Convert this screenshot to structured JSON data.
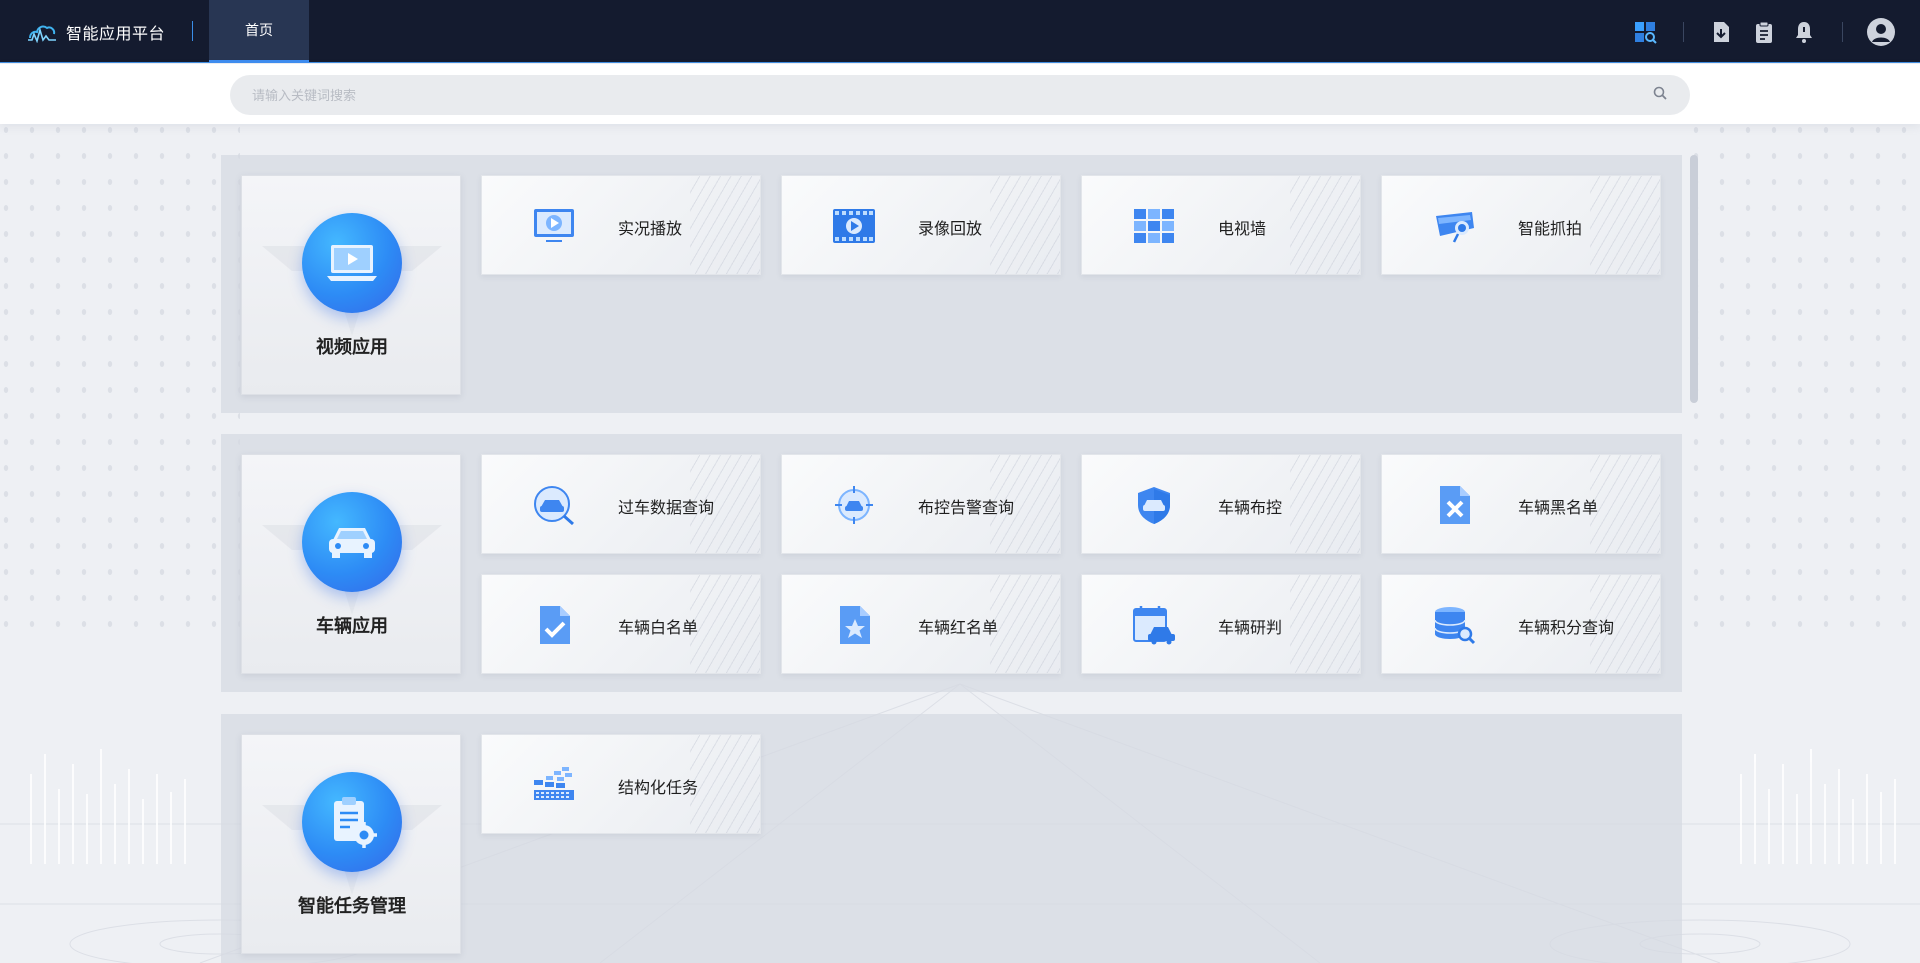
{
  "app": {
    "title": "智能应用平台"
  },
  "nav": {
    "tabs": [
      {
        "label": "首页",
        "active": true
      }
    ]
  },
  "toolbar": {
    "icons": [
      "app-grid-icon",
      "download-file-icon",
      "clipboard-icon",
      "bell-icon",
      "user-avatar-icon"
    ]
  },
  "search": {
    "placeholder": "请输入关键词搜索"
  },
  "colors": {
    "accent": "#2d8bf5",
    "topbar": "#141b2f",
    "active_tab": "#283653"
  },
  "groups": [
    {
      "category": "视频应用",
      "icon": "video-monitor-icon",
      "items": [
        {
          "label": "实况播放",
          "icon": "live-monitor-icon"
        },
        {
          "label": "录像回放",
          "icon": "video-playback-icon"
        },
        {
          "label": "电视墙",
          "icon": "tv-wall-icon"
        },
        {
          "label": "智能抓拍",
          "icon": "camera-capture-icon"
        }
      ]
    },
    {
      "category": "车辆应用",
      "icon": "car-icon",
      "items": [
        {
          "label": "过车数据查询",
          "icon": "car-search-icon"
        },
        {
          "label": "布控告警查询",
          "icon": "target-alarm-icon"
        },
        {
          "label": "车辆布控",
          "icon": "car-shield-icon"
        },
        {
          "label": "车辆黑名单",
          "icon": "blacklist-file-icon"
        },
        {
          "label": "车辆白名单",
          "icon": "whitelist-file-icon"
        },
        {
          "label": "车辆红名单",
          "icon": "redlist-file-icon"
        },
        {
          "label": "车辆研判",
          "icon": "calendar-car-icon"
        },
        {
          "label": "车辆积分查询",
          "icon": "database-search-icon"
        }
      ]
    },
    {
      "category": "智能任务管理",
      "icon": "clipboard-gear-icon",
      "items": [
        {
          "label": "结构化任务",
          "icon": "structured-task-icon"
        }
      ]
    }
  ]
}
